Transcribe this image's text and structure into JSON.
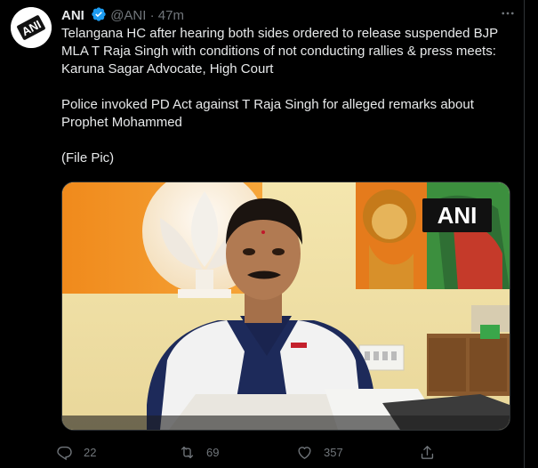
{
  "tweet": {
    "author_name": "ANI",
    "handle": "@ANI",
    "separator": "·",
    "time": "47m",
    "avatar_text": "ANI",
    "paragraphs": [
      "Telangana HC after hearing both sides ordered to release suspended BJP MLA T Raja Singh with conditions of not conducting rallies & press meets: Karuna Sagar Advocate, High Court",
      "Police invoked PD Act against T Raja Singh for alleged remarks about Prophet Mohammed",
      "(File Pic)"
    ],
    "media": {
      "watermark": "ANI"
    },
    "actions": {
      "reply_count": "22",
      "retweet_count": "69",
      "like_count": "357"
    }
  },
  "colors": {
    "background": "#000000",
    "text": "#e7e9ea",
    "secondary": "#71767b",
    "verified": "#1d9bf0"
  }
}
